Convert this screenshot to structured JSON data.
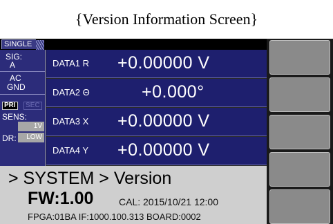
{
  "caption": "{Version Information Screen}",
  "header": {
    "mode_tab": "SINGLE"
  },
  "sidebar": {
    "sig_label": "SIG:",
    "sig_value": "A",
    "coupling_1": "AC",
    "coupling_2": "GND",
    "pri_chip": "PRI",
    "sec_chip": "SEC",
    "sens_label": "SENS:",
    "sens_value": "1V",
    "dr_label": "DR:",
    "dr_value": "LOW"
  },
  "data_rows": [
    {
      "label": "DATA1  R",
      "value": "+0.00000  V"
    },
    {
      "label": "DATA2  Θ",
      "value": "+0.000°"
    },
    {
      "label": "DATA3  X",
      "value": "+0.00000  V"
    },
    {
      "label": "DATA4  Y",
      "value": "+0.00000  V"
    }
  ],
  "bottom": {
    "breadcrumb": "> SYSTEM > Version",
    "fw": "FW:1.00",
    "cal": "CAL: 2015/10/21 12:00",
    "info": "FPGA:01BA  IF:1000.100.313  BOARD:0002"
  },
  "colors": {
    "data_bg": "#1e1f6e",
    "sidebar_bg": "#2c2c7a",
    "panel_gray": "#cfcfcf",
    "softkey_gray": "#8a8a8a"
  }
}
